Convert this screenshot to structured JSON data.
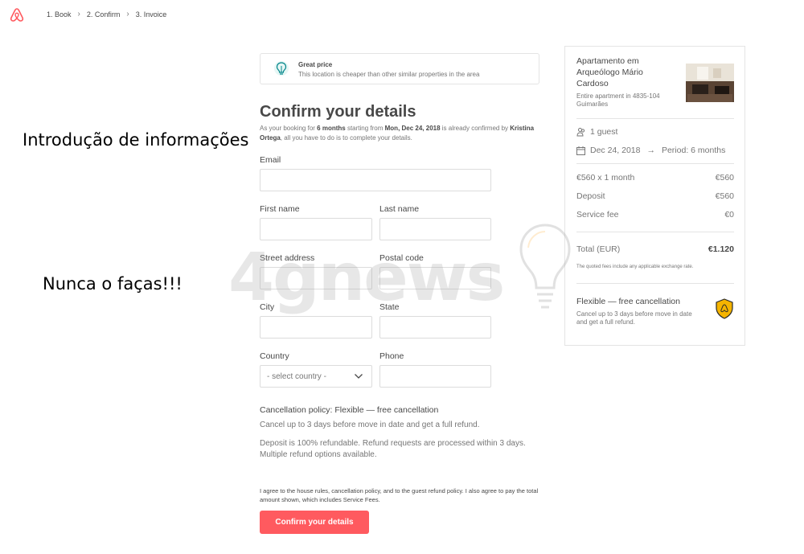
{
  "header": {
    "steps": [
      "1. Book",
      "2. Confirm",
      "3. Invoice"
    ]
  },
  "overlay": {
    "caption1": "Introdução de informações",
    "caption2": "Nunca o faças!!!",
    "watermark": "4gnews"
  },
  "great_price": {
    "title": "Great price",
    "text": "This location is cheaper than other similar properties in the area"
  },
  "form": {
    "title": "Confirm your details",
    "intro": {
      "p1": "As your booking for ",
      "months": "6 months",
      "p2": " starting from ",
      "date": "Mon, Dec 24, 2018",
      "p3": " is already confirmed by ",
      "name": "Kristina Ortega",
      "p4": ", all you have to do is to complete your details."
    },
    "email_label": "Email",
    "first_name_label": "First name",
    "last_name_label": "Last name",
    "street_label": "Street address",
    "postal_label": "Postal code",
    "city_label": "City",
    "state_label": "State",
    "country_label": "Country",
    "country_value": "- select country -",
    "phone_label": "Phone",
    "cancellation_title": "Cancellation policy: Flexible — free cancellation",
    "cancellation_text": "Cancel up to 3 days before move in date and get a full refund.",
    "deposit_text": "Deposit is 100% refundable. Refund requests are processed within 3 days. Multiple refund options available.",
    "agree_text": "I agree to the house rules, cancellation policy, and to the guest refund policy. I also agree to pay the total amount shown, which includes Service Fees.",
    "confirm_button": "Confirm your details"
  },
  "summary": {
    "property_title": "Apartamento em Arqueólogo Mário Cardoso",
    "property_sub": "Entire apartment in 4835-104 Guimarães",
    "guests": "1 guest",
    "start_date": "Dec 24, 2018",
    "period": "Period: 6 months",
    "lines": [
      {
        "label": "€560 x 1 month",
        "value": "€560"
      },
      {
        "label": "Deposit",
        "value": "€560"
      },
      {
        "label": "Service fee",
        "value": "€0"
      }
    ],
    "total_label": "Total (EUR)",
    "total_value": "€1.120",
    "fees_note": "The quoted fees include any applicable exchange rate.",
    "flex_title": "Flexible — free cancellation",
    "flex_text": "Cancel up to 3 days before move in date and get a full refund."
  },
  "colors": {
    "brand": "#ff5a5f",
    "text": "#484848",
    "muted": "#767676",
    "border": "#e4e4e4",
    "badge": "#f5b400"
  }
}
